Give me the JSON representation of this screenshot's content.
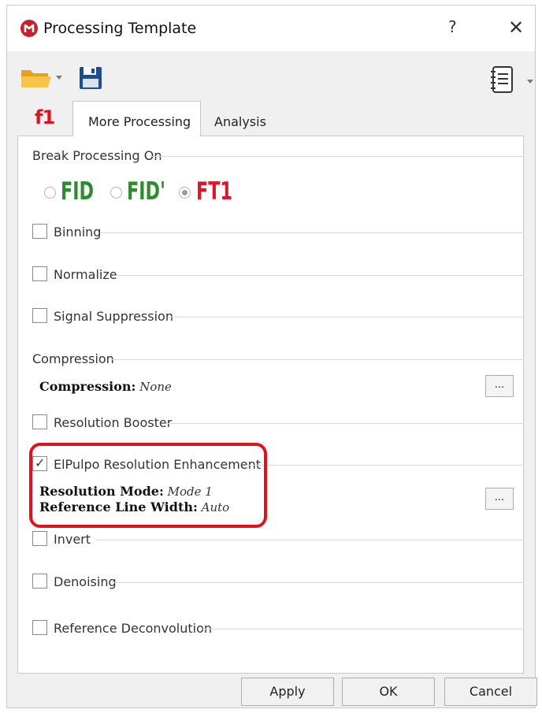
{
  "window": {
    "title": "Processing Template",
    "help_label": "?",
    "close_label": "✕"
  },
  "toolbar": {
    "open_icon": "folder-open-icon",
    "save_icon": "save-icon",
    "notebook_icon": "notebook-icon"
  },
  "tabs": {
    "f1_label": "f1",
    "items": [
      {
        "label": "More Processing",
        "active": true
      },
      {
        "label": "Analysis",
        "active": false
      }
    ]
  },
  "break_processing": {
    "label": "Break Processing On",
    "options": [
      {
        "label": "FID",
        "selected": false,
        "color": "#2e8b2e"
      },
      {
        "label": "FID'",
        "selected": false,
        "color": "#2e8b2e"
      },
      {
        "label": "FT1",
        "selected": true,
        "color": "#d9182a"
      }
    ]
  },
  "sections": {
    "binning": {
      "label": "Binning",
      "checked": false
    },
    "normalize": {
      "label": "Normalize",
      "checked": false
    },
    "signal_suppression": {
      "label": "Signal Suppression",
      "checked": false
    },
    "compression": {
      "label": "Compression",
      "prop_label": "Compression:",
      "prop_value": "None",
      "more_label": "..."
    },
    "resolution_booster": {
      "label": "Resolution Booster",
      "checked": false
    },
    "elpulpo": {
      "label": "ElPulpo Resolution Enhancement",
      "checked": true,
      "mode_label": "Resolution Mode:",
      "mode_value": "Mode 1",
      "width_label": "Reference Line Width:",
      "width_value": "Auto",
      "more_label": "..."
    },
    "invert": {
      "label": "Invert",
      "checked": false
    },
    "denoising": {
      "label": "Denoising",
      "checked": false
    },
    "reference_deconvolution": {
      "label": "Reference Deconvolution",
      "checked": false
    }
  },
  "buttons": {
    "apply": "Apply",
    "ok": "OK",
    "cancel": "Cancel"
  },
  "colors": {
    "highlight": "#e0121e",
    "brand": "#c8202c"
  }
}
